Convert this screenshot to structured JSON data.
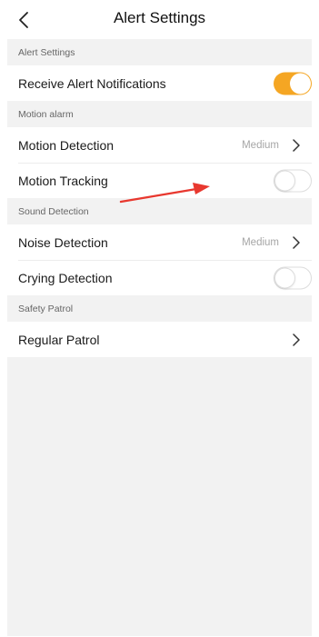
{
  "header": {
    "title": "Alert Settings"
  },
  "colors": {
    "accent": "#f5a623",
    "annotation": "#e8382f"
  },
  "sections": [
    {
      "header": "Alert Settings",
      "items": [
        {
          "label": "Receive Alert Notifications",
          "control": "toggle",
          "on": true
        }
      ]
    },
    {
      "header": "Motion alarm",
      "items": [
        {
          "label": "Motion Detection",
          "value": "Medium",
          "control": "chevron"
        },
        {
          "label": "Motion Tracking",
          "control": "toggle",
          "on": false
        }
      ]
    },
    {
      "header": "Sound Detection",
      "items": [
        {
          "label": "Noise Detection",
          "value": "Medium",
          "control": "chevron"
        },
        {
          "label": "Crying Detection",
          "control": "toggle",
          "on": false
        }
      ]
    },
    {
      "header": "Safety Patrol",
      "items": [
        {
          "label": "Regular Patrol",
          "control": "chevron"
        }
      ]
    }
  ]
}
